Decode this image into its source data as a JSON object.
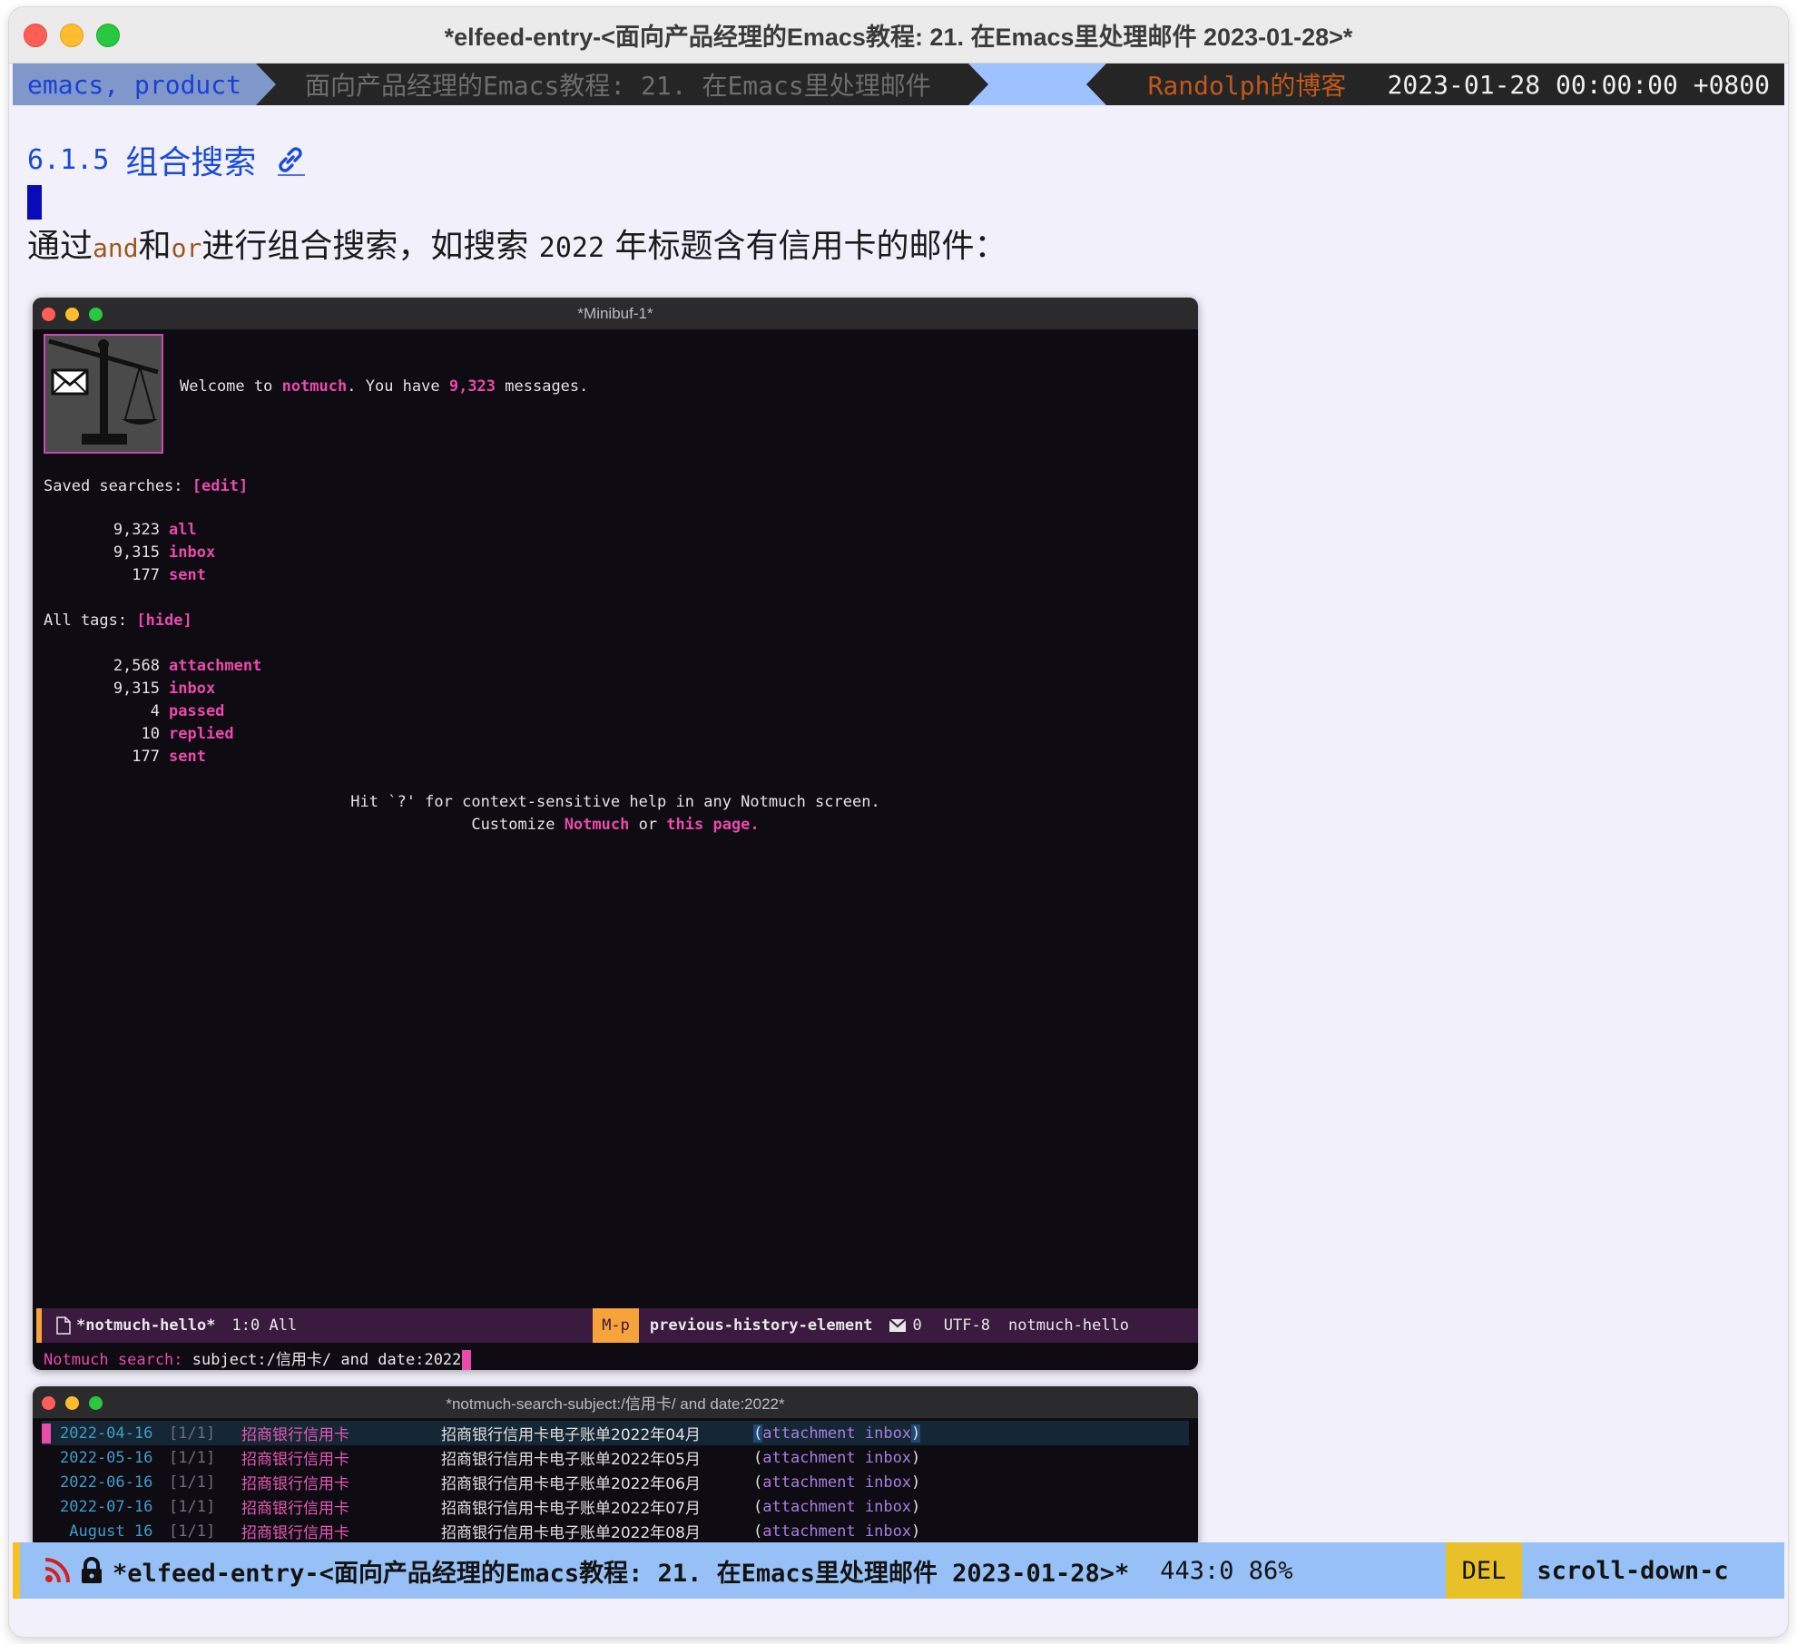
{
  "window": {
    "title": "*elfeed-entry-<面向产品经理的Emacs教程: 21. 在Emacs里处理邮件 2023-01-28>*"
  },
  "headerline": {
    "tags": "emacs, product",
    "entry_title": "面向产品经理的Emacs教程: 21. 在Emacs里处理邮件",
    "feed": "Randolph的博客",
    "date": "2023-01-28 00:00:00 +0800"
  },
  "content": {
    "heading_number": "6.1.5",
    "heading_text": "组合搜索",
    "para": {
      "p1": "通过",
      "and": "and",
      "p2": "和",
      "or": "or",
      "p3": "进行组合搜索，如搜索 ",
      "year": "2022",
      "p4": " 年标题含有信用卡的邮件："
    }
  },
  "shot1": {
    "title": "*Minibuf-1*",
    "welcome_pre": "Welcome to ",
    "welcome_app": "notmuch",
    "welcome_mid": ". You have ",
    "welcome_count": "9,323",
    "welcome_post": " messages.",
    "saved_label": "Saved searches: ",
    "saved_edit": "[edit]",
    "saved": [
      {
        "count": "9,323",
        "name": "all"
      },
      {
        "count": "9,315",
        "name": "inbox"
      },
      {
        "count": "177",
        "name": "sent"
      }
    ],
    "tags_label": "All tags: ",
    "tags_hide": "[hide]",
    "tags": [
      {
        "count": "2,568",
        "name": "attachment"
      },
      {
        "count": "9,315",
        "name": "inbox"
      },
      {
        "count": "4",
        "name": "passed"
      },
      {
        "count": "10",
        "name": "replied"
      },
      {
        "count": "177",
        "name": "sent"
      }
    ],
    "help_line": "Hit `?' for context-sensitive help in any Notmuch screen.",
    "customize_pre": "Customize ",
    "customize_notmuch": "Notmuch",
    "customize_or": " or ",
    "customize_page": "this page.",
    "modeline": {
      "buffer": "*notmuch-hello*",
      "position": "1:0 All",
      "key": "M-p",
      "command": "previous-history-element",
      "mail_count": "0",
      "encoding": "UTF-8",
      "mode": "notmuch-hello"
    },
    "minibuffer_prompt": "Notmuch search: ",
    "minibuffer_input": "subject:/信用卡/ and date:2022"
  },
  "shot2": {
    "title": "*notmuch-search-subject:/信用卡/ and date:2022*",
    "rows": [
      {
        "date": "2022-04-16",
        "count": "[1/1]",
        "author": "招商银行信用卡",
        "subject": "招商银行信用卡电子账单2022年04月",
        "tag1": "attachment",
        "tag2": "inbox"
      },
      {
        "date": "2022-05-16",
        "count": "[1/1]",
        "author": "招商银行信用卡",
        "subject": "招商银行信用卡电子账单2022年05月",
        "tag1": "attachment",
        "tag2": "inbox"
      },
      {
        "date": "2022-06-16",
        "count": "[1/1]",
        "author": "招商银行信用卡",
        "subject": "招商银行信用卡电子账单2022年06月",
        "tag1": "attachment",
        "tag2": "inbox"
      },
      {
        "date": "2022-07-16",
        "count": "[1/1]",
        "author": "招商银行信用卡",
        "subject": "招商银行信用卡电子账单2022年07月",
        "tag1": "attachment",
        "tag2": "inbox"
      },
      {
        "date": " August 16",
        "count": "[1/1]",
        "author": "招商银行信用卡",
        "subject": "招商银行信用卡电子账单2022年08月",
        "tag1": "attachment",
        "tag2": "inbox"
      }
    ]
  },
  "modeline": {
    "buffer": "*elfeed-entry-<面向产品经理的Emacs教程: 21. 在Emacs里处理邮件 2023-01-28>*",
    "position": "443:0 86%",
    "key": "DEL",
    "command": "scroll-down-c"
  },
  "icons": [
    "rss-icon",
    "lock-icon",
    "link-icon",
    "file-icon",
    "mail-icon",
    "scale-logo-icon"
  ],
  "colors": {
    "accent_pink": "#ea4aaa",
    "heading_blue": "#1a4bd6",
    "modeline_blue": "#97c0f6",
    "key_yellow": "#e7c02a"
  }
}
